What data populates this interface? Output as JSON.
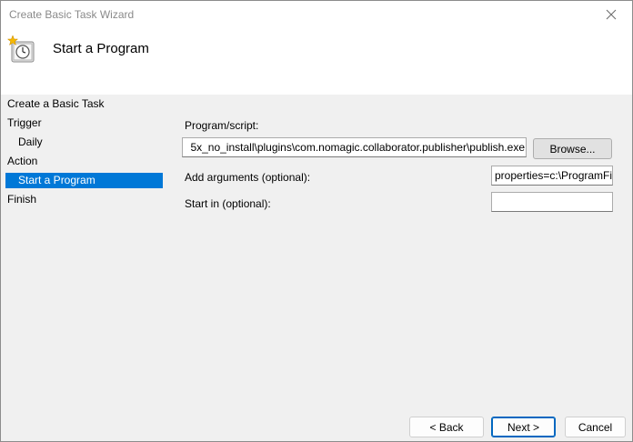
{
  "window": {
    "title": "Create Basic Task Wizard"
  },
  "header": {
    "title": "Start a Program",
    "icon": "task-clock-icon"
  },
  "nav": {
    "items": [
      {
        "label": "Create a Basic Task",
        "indent": false,
        "selected": false
      },
      {
        "label": "Trigger",
        "indent": false,
        "selected": false
      },
      {
        "label": "Daily",
        "indent": true,
        "selected": false
      },
      {
        "label": "Action",
        "indent": false,
        "selected": false
      },
      {
        "label": "Start a Program",
        "indent": true,
        "selected": true
      },
      {
        "label": "Finish",
        "indent": false,
        "selected": false
      }
    ]
  },
  "form": {
    "program_label": "Program/script:",
    "program_value": "5x_no_install\\plugins\\com.nomagic.collaborator.publisher\\publish.exe",
    "browse_label": "Browse...",
    "args_label": "Add arguments (optional):",
    "args_value": "properties=c:\\ProgramFi",
    "startin_label": "Start in (optional):",
    "startin_value": ""
  },
  "footer": {
    "back_label": "< Back",
    "next_label": "Next >",
    "cancel_label": "Cancel"
  },
  "colors": {
    "selection": "#0078d7",
    "default_button_border": "#0067c0"
  }
}
